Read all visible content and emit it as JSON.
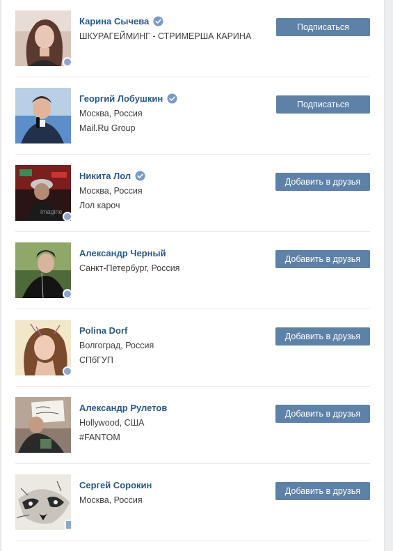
{
  "people": [
    {
      "name": "Карина Сычева",
      "verified": true,
      "line1": "ШКУРАГЕЙМИНГ - СТРИМЕРША КАРИНА",
      "line2": "",
      "status": "online",
      "button": "Подписаться",
      "avatar_desc": "portrait-photo"
    },
    {
      "name": "Георгий Лобушкин",
      "verified": true,
      "line1": "Москва, Россия",
      "line2": "Mail.Ru Group",
      "status": "",
      "button": "Подписаться",
      "avatar_desc": "portrait-photo"
    },
    {
      "name": "Никита Лол",
      "verified": true,
      "line1": "Москва, Россия",
      "line2": "Лол кароч",
      "status": "online",
      "button": "Добавить в друзья",
      "avatar_desc": "portrait-photo"
    },
    {
      "name": "Александр Черный",
      "verified": false,
      "line1": "Санкт-Петербург, Россия",
      "line2": "",
      "status": "online",
      "button": "Добавить в друзья",
      "avatar_desc": "portrait-photo"
    },
    {
      "name": "Polina Dorf",
      "verified": false,
      "line1": "Волгоград, Россия",
      "line2": "СПбГУП",
      "status": "online",
      "button": "Добавить в друзья",
      "avatar_desc": "portrait-photo"
    },
    {
      "name": "Александр Рулетов",
      "verified": false,
      "line1": "Hollywood, США",
      "line2": "#FANTOM",
      "status": "",
      "button": "Добавить в друзья",
      "avatar_desc": "portrait-photo"
    },
    {
      "name": "Сергей Сорокин",
      "verified": false,
      "line1": "Москва, Россия",
      "line2": "",
      "status": "online-mobile",
      "button": "Добавить в друзья",
      "avatar_desc": "raccoon-drawing"
    }
  ],
  "colors": {
    "link": "#2a5885",
    "button": "#5e81a8",
    "online": "#8ca6d0",
    "verified": "#7a9ac4"
  }
}
